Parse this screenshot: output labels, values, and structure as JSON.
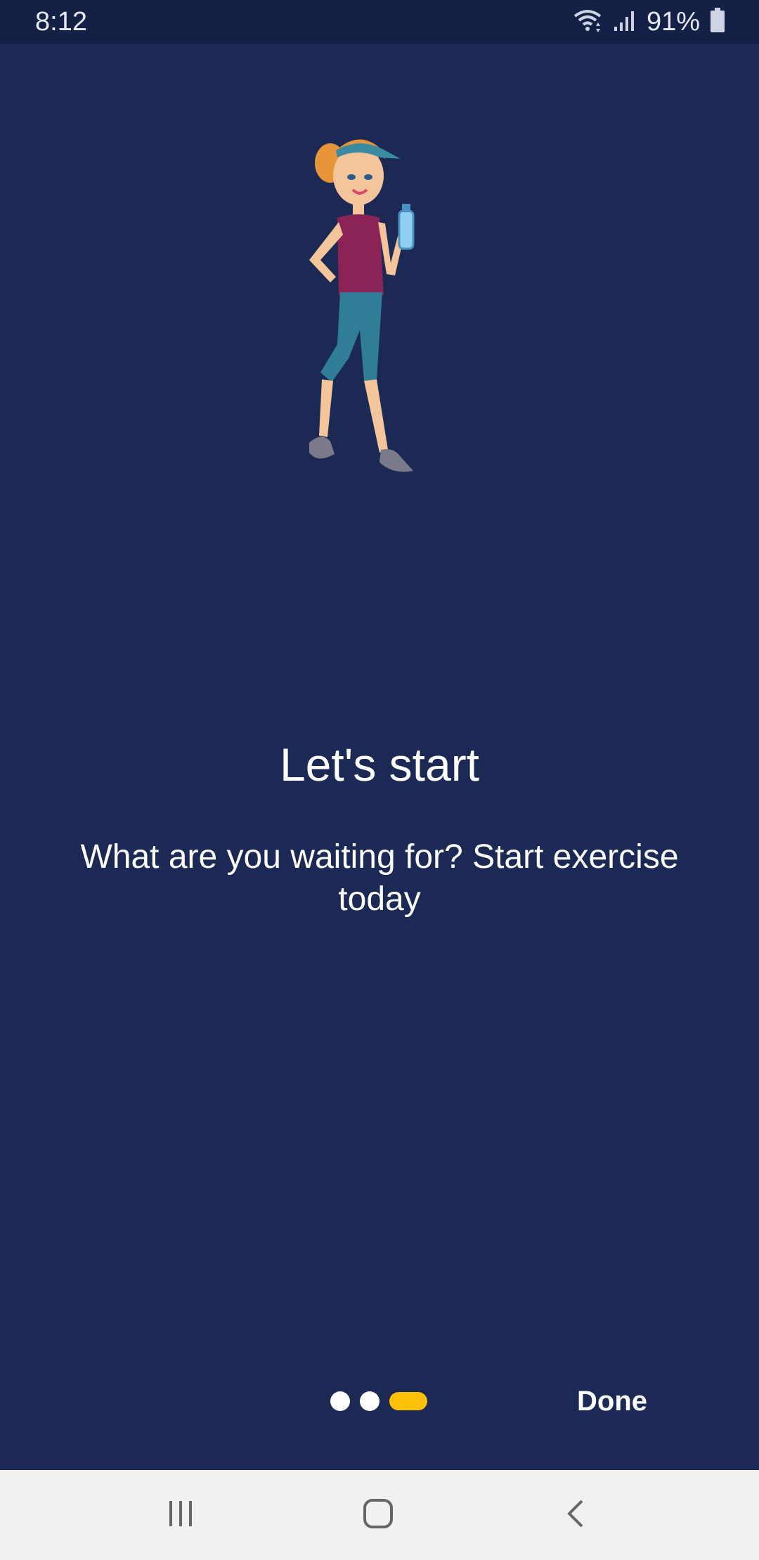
{
  "status_bar": {
    "time": "8:12",
    "battery_percent": "91%",
    "icons": [
      "wifi-icon",
      "signal-icon",
      "battery-icon"
    ]
  },
  "onboarding": {
    "illustration": "woman-walking-with-water-bottle",
    "title": "Let's start",
    "subtitle": "What are you waiting for? Start exercise today",
    "pager": {
      "total_pages": 3,
      "current_page": 3
    },
    "done_label": "Done"
  },
  "nav_bar": {
    "icons": [
      "recents-icon",
      "home-icon",
      "back-icon"
    ]
  },
  "colors": {
    "background": "#1c2955",
    "status_bar": "#142046",
    "accent": "#ffc107",
    "nav_bar": "#f1f1f1"
  }
}
